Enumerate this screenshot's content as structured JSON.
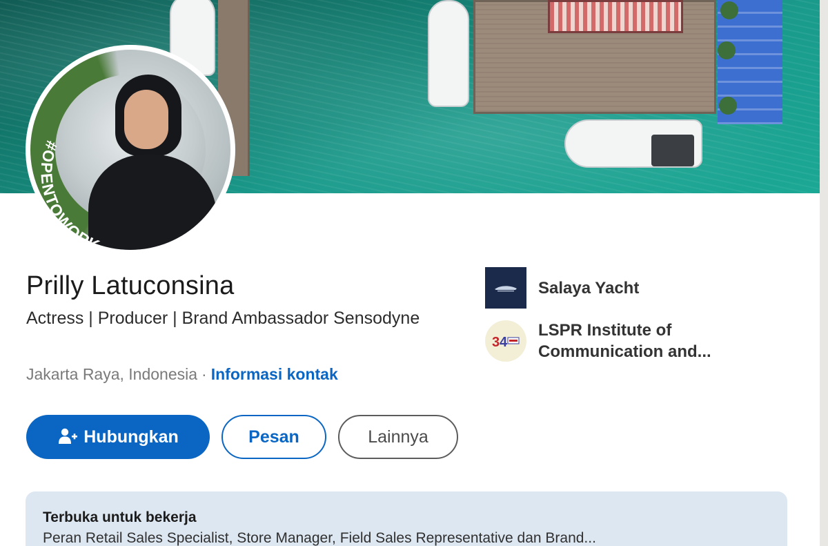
{
  "profile": {
    "name": "Prilly Latuconsina",
    "headline": "Actress | Producer | Brand Ambassador Sensodyne",
    "location": "Jakarta Raya, Indonesia",
    "separator": "·",
    "contact_link": "Informasi kontak",
    "avatar_badge": "#OPENTOWORK"
  },
  "actions": {
    "connect_label": "Hubungkan",
    "message_label": "Pesan",
    "more_label": "Lainnya"
  },
  "organizations": [
    {
      "name": "Salaya Yacht",
      "icon": "salaya-yacht-logo"
    },
    {
      "name": "LSPR Institute of Communication and...",
      "icon": "lspr-logo"
    }
  ],
  "open_to_work": {
    "title": "Terbuka untuk bekerja",
    "description": "Peran Retail Sales Specialist, Store Manager, Field Sales Representative dan Brand..."
  },
  "colors": {
    "primary_blue": "#0a66c2",
    "otw_green": "#4a7a37",
    "otw_box": "#dde7f1"
  }
}
